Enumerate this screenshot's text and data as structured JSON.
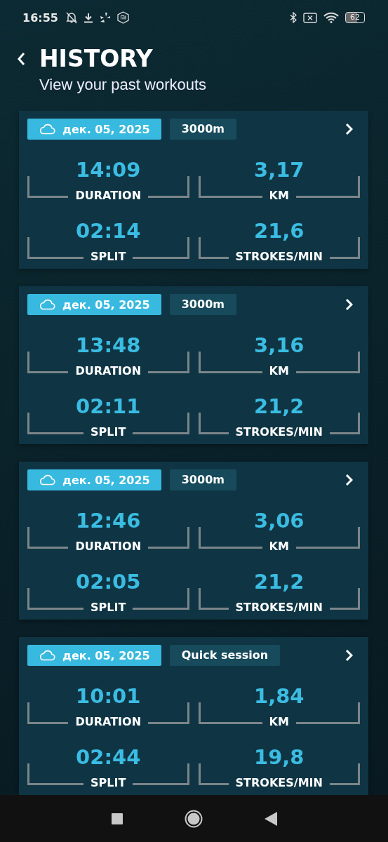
{
  "status_bar": {
    "time": "16:55",
    "battery": "62"
  },
  "header": {
    "title": "HISTORY",
    "subtitle": "View your past workouts"
  },
  "workouts": [
    {
      "date": "дек. 05, 2025",
      "type": "3000m",
      "metrics": [
        {
          "value": "14:09",
          "label": "DURATION"
        },
        {
          "value": "3,17",
          "label": "KM"
        },
        {
          "value": "02:14",
          "label": "SPLIT"
        },
        {
          "value": "21,6",
          "label": "STROKES/MIN"
        }
      ]
    },
    {
      "date": "дек. 05, 2025",
      "type": "3000m",
      "metrics": [
        {
          "value": "13:48",
          "label": "DURATION"
        },
        {
          "value": "3,16",
          "label": "KM"
        },
        {
          "value": "02:11",
          "label": "SPLIT"
        },
        {
          "value": "21,2",
          "label": "STROKES/MIN"
        }
      ]
    },
    {
      "date": "дек. 05, 2025",
      "type": "3000m",
      "metrics": [
        {
          "value": "12:46",
          "label": "DURATION"
        },
        {
          "value": "3,06",
          "label": "KM"
        },
        {
          "value": "02:05",
          "label": "SPLIT"
        },
        {
          "value": "21,2",
          "label": "STROKES/MIN"
        }
      ]
    },
    {
      "date": "дек. 05, 2025",
      "type": "Quick session",
      "metrics": [
        {
          "value": "10:01",
          "label": "DURATION"
        },
        {
          "value": "1,84",
          "label": "KM"
        },
        {
          "value": "02:44",
          "label": "SPLIT"
        },
        {
          "value": "19,8",
          "label": "STROKES/MIN"
        }
      ]
    }
  ]
}
